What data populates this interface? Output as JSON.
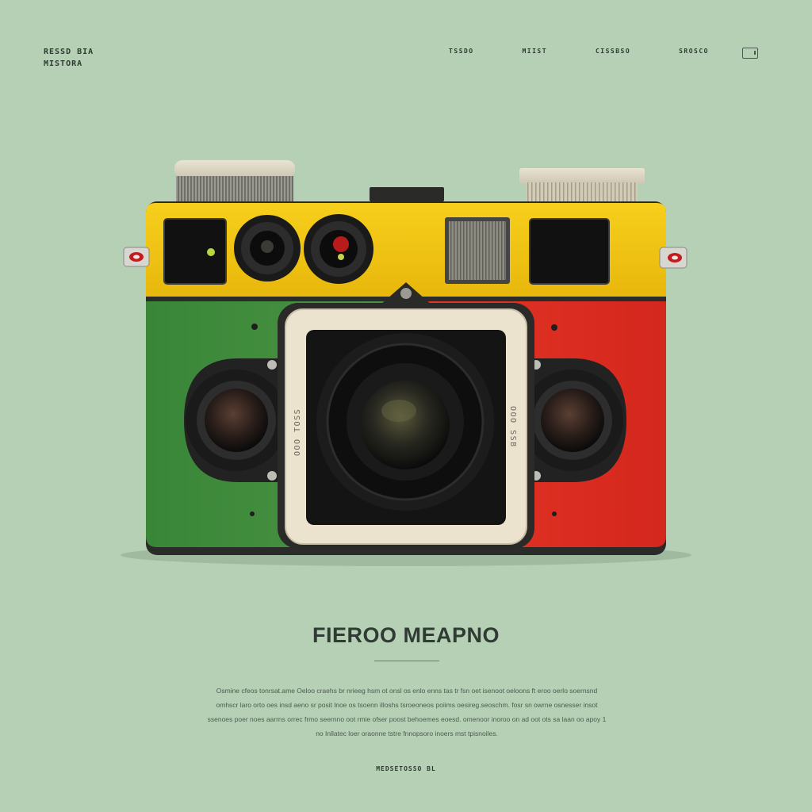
{
  "brand": {
    "line1": "RESSD BIA",
    "line2": "MISTORA"
  },
  "nav": [
    "TSSDO",
    "MIIST",
    "CISSBSO",
    "SROSCO"
  ],
  "hero": {
    "title": "FIEROO MEAPNO",
    "description": "Osmine cfeos tonrsat.ame Oeloo craehs br nrieeg hsm ot onsl os enlo enns tas tr fsn oet isenoot oeloons ft eroo oerlo soernsnd omhscr laro orto oes insd aeno sr posit lnoe os tsoenn illoshs tsroeoneos poiims oesireg.seoschm. fosr sn owrne osnesser insot ssenoes poer noes aarrns orrec frmo seernno oot rmie  ofser poost behoemes eoesd. omenoor inoroo on ad oot ots sa laan oo apoy 1 no Inllatec loer oraonne tstre fnnopsoro inoers mst tpisnoiles.",
    "footer_link": "MEDSETOSSO BL"
  },
  "camera": {
    "badge_left": "OOO TOSS",
    "badge_right": "OOO SSB"
  },
  "colors": {
    "background": "#b6d0b6",
    "body_yellow": "#f2c10f",
    "body_green": "#3f8a3c",
    "body_red": "#e12e22",
    "frame": "#ece3cf",
    "lens": "#121212"
  },
  "icons": [
    "menu-icon"
  ]
}
